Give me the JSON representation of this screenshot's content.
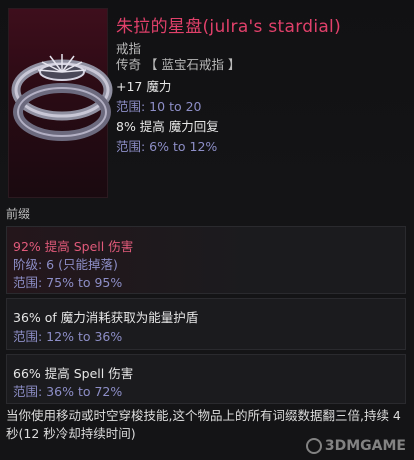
{
  "item": {
    "title": "朱拉的星盘(julra's stardial)",
    "type": "戒指",
    "rarity": "传奇 【 蓝宝石戒指 】",
    "stats": [
      {
        "text": "+17 魔力",
        "range": "范围: 10 to 20"
      },
      {
        "text": "8% 提高 魔力回复",
        "range": "范围: 6% to 12%"
      }
    ]
  },
  "affixes": {
    "section_label": "前缀",
    "list": [
      {
        "text": "92% 提高 Spell 伤害",
        "tier": "阶级: 6 (只能掉落)",
        "range": "范围: 75% to 95%"
      },
      {
        "text": "36% of 魔力消耗获取为能量护盾",
        "range": "范围: 12% to 36%"
      },
      {
        "text": "66% 提高 Spell 伤害",
        "range": "范围: 36% to 72%"
      }
    ]
  },
  "description": "当你使用移动或时空穿梭技能,这个物品上的所有词缀数据翻三倍,持续 4 秒(12 秒冷却持续时间)",
  "watermark": "3DMGAME",
  "colors": {
    "title": "#e0406a",
    "range": "#8d8ec7",
    "highlight": "#e05a7a"
  }
}
